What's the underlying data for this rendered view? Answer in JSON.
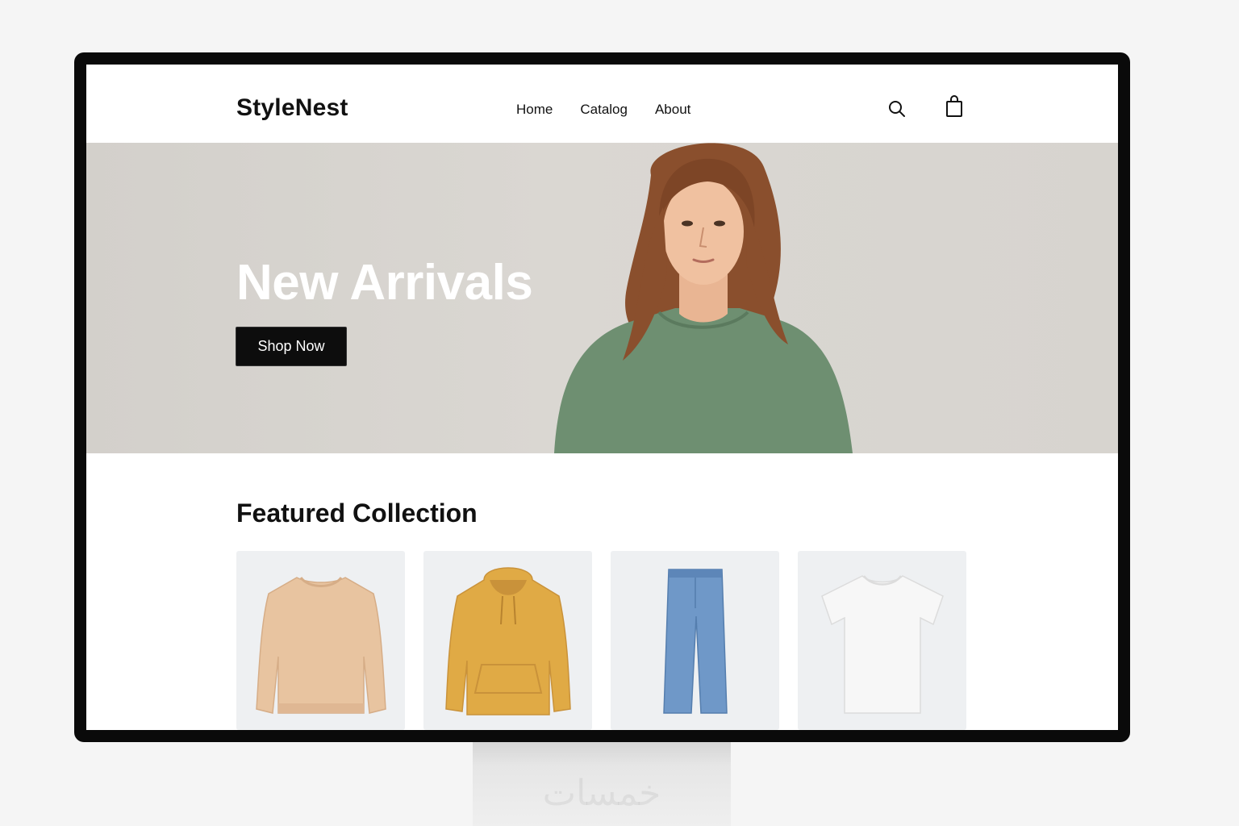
{
  "brand": {
    "name": "StyleNest"
  },
  "nav": {
    "items": [
      {
        "label": "Home"
      },
      {
        "label": "Catalog"
      },
      {
        "label": "About"
      }
    ]
  },
  "header_icons": [
    "search-icon",
    "shopping-bag-icon"
  ],
  "hero": {
    "title": "New Arrivals",
    "cta_label": "Shop Now"
  },
  "featured": {
    "title": "Featured Collection",
    "products": [
      {
        "name": "sweater",
        "color": "#e8c4a0"
      },
      {
        "name": "hoodie",
        "color": "#e0aa45"
      },
      {
        "name": "jeans",
        "color": "#6f98c8"
      },
      {
        "name": "t-shirt",
        "color": "#f7f7f7"
      }
    ]
  },
  "stand": {
    "watermark": "خمسات"
  },
  "colors": {
    "bezel": "#0a0a0a",
    "hero_bg": "#d7d4cf",
    "button": "#0d0d0d",
    "card_bg": "#eef0f2",
    "model_sweater": "#6e8f71"
  }
}
